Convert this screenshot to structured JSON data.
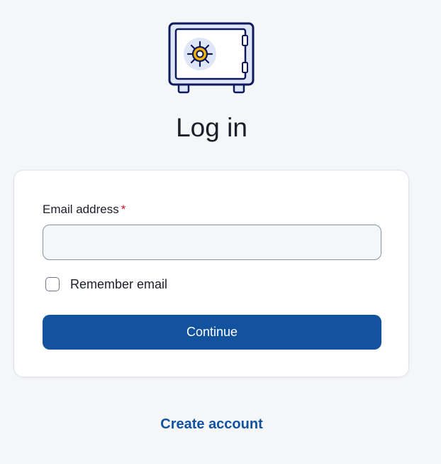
{
  "logo": {
    "icon": "safe-icon",
    "colors": {
      "outline": "#0f1a5c",
      "body": "#dfe6f8",
      "dial": "#f4b400"
    }
  },
  "page": {
    "title": "Log in"
  },
  "form": {
    "email": {
      "label": "Email address",
      "required_marker": "*",
      "value": "",
      "placeholder": ""
    },
    "remember": {
      "label": "Remember email",
      "checked": false
    },
    "submit_label": "Continue"
  },
  "links": {
    "create_account": "Create account"
  },
  "colors": {
    "primary": "#12529f",
    "required": "#c8102e",
    "background": "#f5f6f8"
  }
}
